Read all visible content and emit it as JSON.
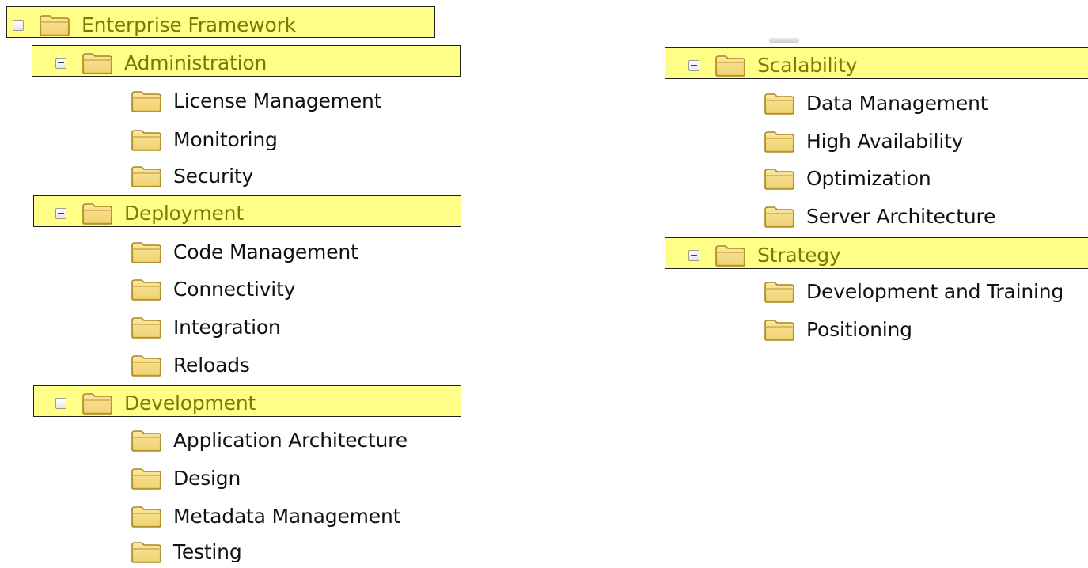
{
  "colors": {
    "highlight_fill": "#ffff88",
    "highlight_border": "#222222",
    "category_text": "#7a7a00",
    "item_text": "#111111",
    "folder_fill": "#f2d77a",
    "folder_outline": "#a7861f"
  },
  "icons": {
    "expander": "minus-box-icon",
    "folder": "folder-icon"
  },
  "tree": {
    "root": {
      "label": "Enterprise Framework",
      "expanded": true
    },
    "administration": {
      "label": "Administration",
      "expanded": true,
      "items": [
        "License Management",
        "Monitoring",
        "Security"
      ]
    },
    "deployment": {
      "label": "Deployment",
      "expanded": true,
      "items": [
        "Code Management",
        "Connectivity",
        "Integration",
        "Reloads"
      ]
    },
    "development": {
      "label": "Development",
      "expanded": true,
      "items": [
        "Application Architecture",
        "Design",
        "Metadata Management",
        "Testing"
      ]
    },
    "scalability": {
      "label": "Scalability",
      "expanded": true,
      "items": [
        "Data Management",
        "High Availability",
        "Optimization",
        "Server Architecture"
      ]
    },
    "strategy": {
      "label": "Strategy",
      "expanded": true,
      "items": [
        "Development and Training",
        "Positioning"
      ]
    }
  }
}
